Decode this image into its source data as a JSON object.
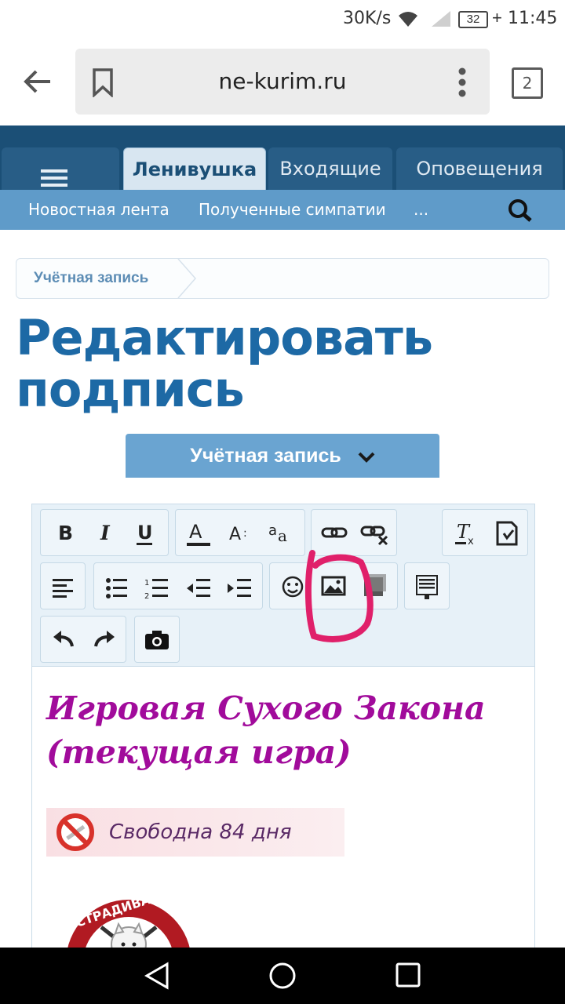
{
  "status": {
    "speed": "30K/s",
    "battery": "32",
    "time": "11:45"
  },
  "browser": {
    "url": "ne-kurim.ru",
    "tabs_count": "2"
  },
  "site_nav": {
    "tabs": [
      {
        "label": "Ленивушка"
      },
      {
        "label": "Входящие"
      },
      {
        "label": "Оповещения"
      }
    ],
    "sub": [
      {
        "label": "Новостная лента"
      },
      {
        "label": "Полученные симпатии"
      },
      {
        "label": "..."
      }
    ]
  },
  "page": {
    "breadcrumb": "Учётная запись",
    "title": "Редактировать подпись",
    "account_button": "Учётная запись"
  },
  "editor": {
    "heading": "Игровая Сухого Закона (текущая игра)",
    "banner_text": "Свободна 84 дня",
    "logo_text": "СТРАДИВАРИ"
  },
  "colors": {
    "header": "#1b4f76",
    "accent": "#1d69a5",
    "subnav": "#5f9bc9",
    "annotation": "#e0206a",
    "heading": "#a10b9b"
  }
}
